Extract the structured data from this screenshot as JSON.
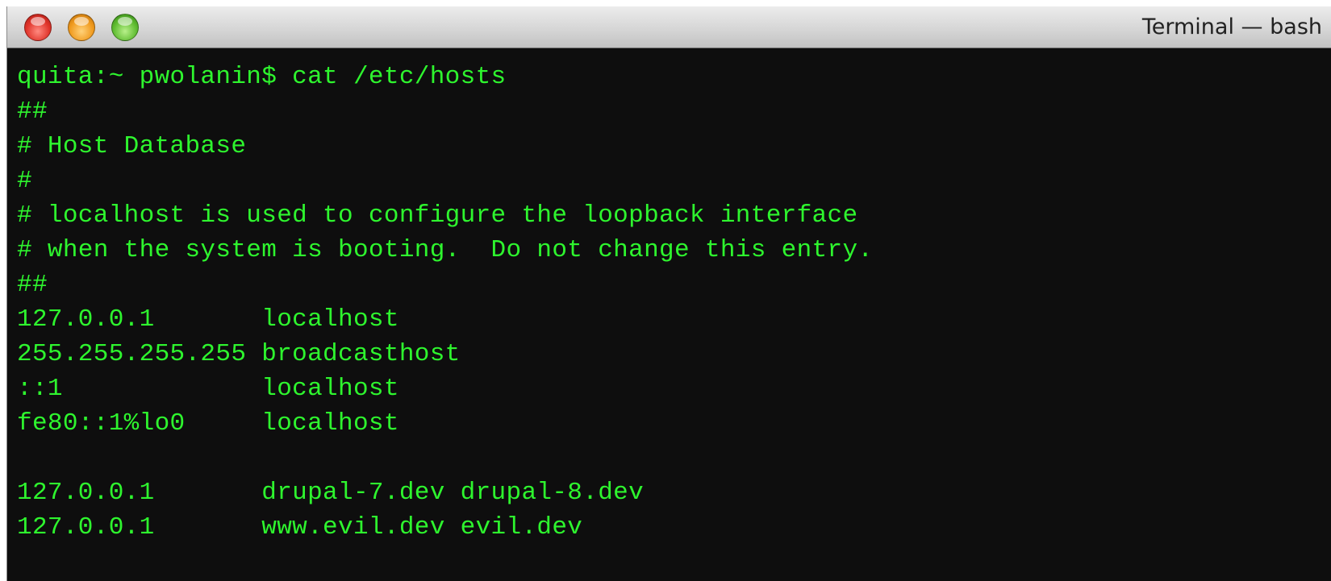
{
  "window": {
    "title": "Terminal — bash"
  },
  "colors": {
    "terminal_background": "#0e0e0e",
    "terminal_text": "#2ef52e",
    "close_button": "#e0342a",
    "minimize_button": "#f09a1e",
    "zoom_button": "#5fbc31"
  },
  "icons": {
    "close": "close-icon",
    "minimize": "minimize-icon",
    "zoom": "zoom-icon"
  },
  "terminal": {
    "lines": [
      "quita:~ pwolanin$ cat /etc/hosts",
      "##",
      "# Host Database",
      "#",
      "# localhost is used to configure the loopback interface",
      "# when the system is booting.  Do not change this entry.",
      "##",
      "127.0.0.1       localhost",
      "255.255.255.255 broadcasthost",
      "::1             localhost",
      "fe80::1%lo0     localhost",
      "",
      "127.0.0.1       drupal-7.dev drupal-8.dev",
      "127.0.0.1       www.evil.dev evil.dev"
    ]
  }
}
